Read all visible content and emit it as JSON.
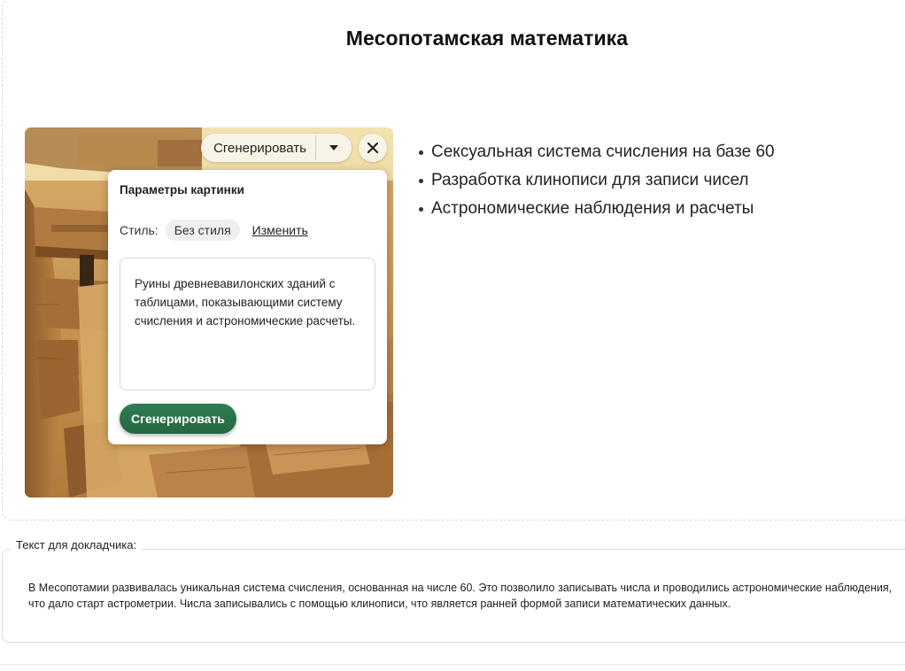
{
  "slide": {
    "title": "Месопотамская математика"
  },
  "image": {
    "description_icon": "ruins-photo"
  },
  "toolbar": {
    "generate_label": "Сгенерировать",
    "caret_icon": "caret-down-icon",
    "close_icon": "close-icon"
  },
  "image_params": {
    "title": "Параметры картинки",
    "style_label": "Стиль:",
    "style_value": "Без стиля",
    "change_label": "Изменить",
    "prompt": "Руины древневавилонских зданий с таблицами, показывающими систему счисления и астрономические расчеты.",
    "generate_label": "Сгенерировать"
  },
  "bullets": [
    "Сексуальная система счисления на базе 60",
    "Разработка клинописи для записи чисел",
    "Астрономические наблюдения и расчеты"
  ],
  "notes": {
    "label": "Текст для докладчика:",
    "text": "В Месопотамии развивалась уникальная система счисления, основанная на числе 60. Это позволило записывать числа и проводились астрономические наблюдения, что дало старт астрометрии. Числа записывались с помощью клинописи, что является ранней формой записи математических данных."
  },
  "colors": {
    "accent_green": "#2f7d55",
    "panel_bg": "#ffffff",
    "sand": "#c9954f"
  }
}
